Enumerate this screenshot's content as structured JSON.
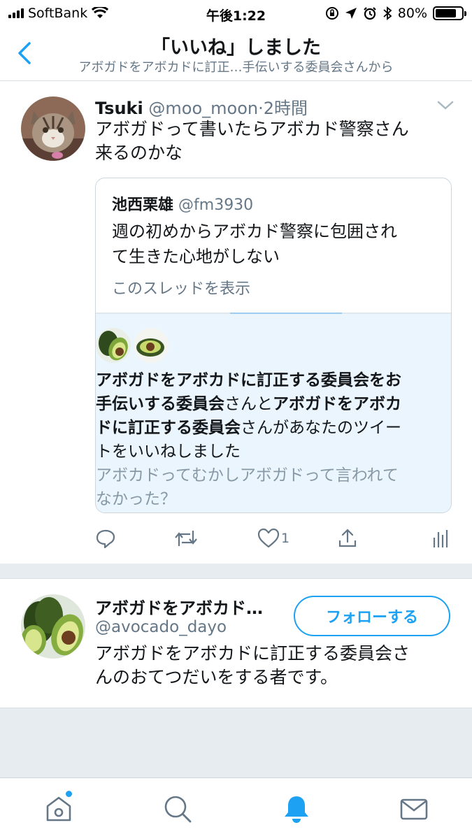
{
  "status_bar": {
    "carrier": "SoftBank",
    "time": "午後1:22",
    "battery": "80%",
    "battery_level": 0.8
  },
  "header": {
    "back_icon": "chevron-left-icon",
    "title": "「いいね」しました",
    "subtitle": "アボガドをアボカドに訂正…手伝いする委員会さんから"
  },
  "tweet": {
    "name": "Tsuki",
    "handle": "@moo_moon",
    "separator": "·",
    "time": "2時間",
    "text_lines": [
      "アボガドって書いたらアボカド警察さん",
      "来るのかな"
    ],
    "quote": {
      "name": "池西栗雄",
      "handle": "@fm3930",
      "text_lines": [
        "週の初めからアボカド警察に包囲され",
        "て生きた心地がしない"
      ],
      "show_thread": "このスレッドを表示"
    },
    "activity": {
      "line1_bold": "アボガドをアボカドに訂正する委員会をお",
      "line2_bold_a": "手伝いする委員会",
      "line2_normal": "さんと",
      "line2_bold_b": "アボガドをアボカ",
      "line3_bold": "ドに訂正する委員会",
      "line3_normal": "さんがあなたのツイー",
      "line4": "トをいいねしました",
      "sub_lines": [
        "アボカドってむかしアボガドって言われて",
        "なかった？"
      ]
    },
    "actions": {
      "reply_icon": "reply-icon",
      "retweet_icon": "retweet-icon",
      "like_icon": "heart-icon",
      "like_count": "1",
      "share_icon": "share-icon",
      "analytics_icon": "analytics-icon"
    }
  },
  "user_card": {
    "name": "アボガドをアボカド…",
    "handle": "@avocado_dayo",
    "bio_lines": [
      "アボガドをアボカドに訂正する委員会さ",
      "んのおてつだいをする者です。"
    ],
    "follow_label": "フォローする"
  },
  "tab_bar": {
    "items": [
      "home-icon",
      "search-icon",
      "notifications-icon",
      "messages-icon"
    ],
    "active": "notifications-icon"
  },
  "colors": {
    "accent": "#1da1f2",
    "secondary_text": "#657786",
    "divider": "#e6ecf0",
    "activity_bg": "#eaf5fe"
  }
}
